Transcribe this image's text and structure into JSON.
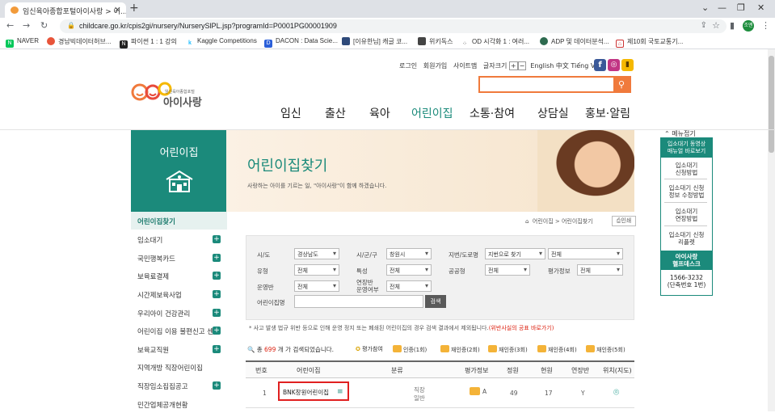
{
  "browser": {
    "tab_title": "임신육아종합포털아이사랑 > 어...",
    "url": "childcare.go.kr/cpis2gi/nursery/NurserySlPL.jsp?programId=P0001PG00001909",
    "profile_label": "조엔",
    "bookmarks": [
      "NAVER",
      "경남빅데이터허브...",
      "파이썬 1 : 1 강의",
      "Kaggle Competitions",
      "DACON : Data Scie...",
      "[이유한님] 캐글 코...",
      "위키독스",
      "OD 시각화 1 : 여러...",
      "ADP 및 데이터분석...",
      "제10회 국토교통기..."
    ]
  },
  "site": {
    "toplinks": [
      "로그인",
      "회원가입",
      "사이트맵",
      "글자크기"
    ],
    "lang": "English 中文 Tiếng Việt",
    "logo_small": "임신육아종합포털",
    "logo_big": "아이사랑",
    "gnb": [
      "임신",
      "출산",
      "육아",
      "어린이집",
      "소통·참여",
      "상담실",
      "홍보·알림"
    ],
    "lnb_title": "어린이집",
    "lnb_items": [
      "어린이집찾기",
      "임소대기",
      "국민행복카드",
      "보육료결제",
      "시간제보육사업",
      "우리아이 건강관리",
      "어린이집 이용 불편신고 센터",
      "보육교직원",
      "지역개방 직장어린이집",
      "직장임소집집공고",
      "민간업체공개현황"
    ],
    "page_title": "어린이집찾기",
    "page_sub": "사랑하는 아이를 기르는 일, \"아이사랑\"이 함께 하겠습니다.",
    "breadcrumb": "어린이집 > 어린이집찾기",
    "print": "인쇄"
  },
  "form": {
    "labels": {
      "sido": "시/도",
      "sigungu": "시/군/구",
      "road": "지번/도로명",
      "type": "유형",
      "feature": "특성",
      "public": "공공형",
      "grade": "평가정보",
      "operation": "운영반",
      "extended": "연장반\n운영여부",
      "name": "어린이집명"
    },
    "values": {
      "sido": "경상남도",
      "sigungu": "창원시",
      "road": "지번으로 찾기",
      "road2": "전체",
      "type": "전체",
      "feature": "전체",
      "public": "전체",
      "grade": "전체",
      "operation": "전체",
      "extended": "전체"
    },
    "search_btn": "검색"
  },
  "notice": {
    "text": "* 사고 발생 법규 위반 등으로 인해 운영 정지 또는 폐쇄된 어린이집의 경우 검색 결과에서 제외됩니다.",
    "link": "(위반사실의 공표 바로가기)"
  },
  "results": {
    "prefix": "총",
    "count": "699",
    "suffix": "개 가 검색되었습니다.",
    "legend": [
      "평가참여",
      "인증(1회)",
      "재인증(2회)",
      "재인증(3회)",
      "재인증(4회)",
      "재인증(5회)"
    ]
  },
  "table": {
    "headers": [
      "번호",
      "어린이집",
      "분류",
      "평가정보",
      "정원",
      "현원",
      "연장반",
      "위치(지도)"
    ],
    "rows": [
      {
        "no": "1",
        "name": "BNK창원어린이집",
        "type1": "직장",
        "type2": "일반",
        "grade": "A",
        "capacity": "49",
        "current": "17",
        "extended": "Y"
      }
    ]
  },
  "quick": {
    "fold": "메뉴접기",
    "items": [
      "입소대기 동영상\n매뉴얼 바로보기",
      "입소대기\n신청방법",
      "입소대기 신청\n정보 수정방법",
      "입소대기\n연장방법",
      "입소대기 신청\n리플렛"
    ],
    "help_title": "아이사랑\n헬프데스크",
    "phone": "1566-3232\n(단축번호 1번)"
  },
  "colors": {
    "brand": "#1b8a7b",
    "accent": "#f07a3c",
    "red": "#e02020"
  }
}
